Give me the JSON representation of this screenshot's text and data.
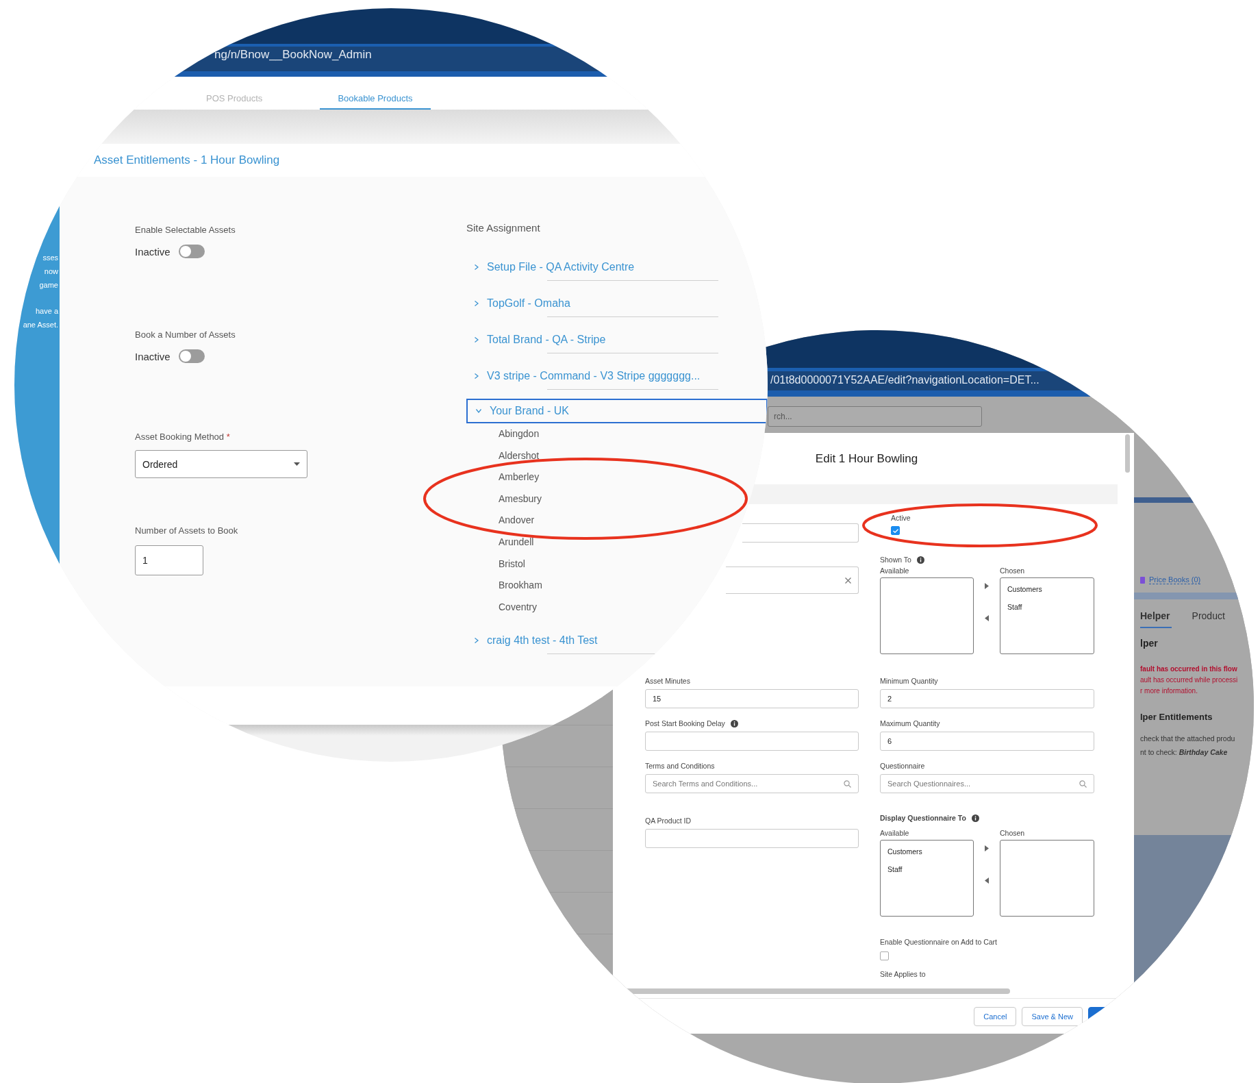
{
  "left_screen": {
    "url": "ng/n/Bnow__BookNow_Admin",
    "tabs": [
      {
        "label": "POS Products",
        "selected": false
      },
      {
        "label": "Bookable Products",
        "selected": true
      }
    ],
    "sidebar_lines": [
      "sses",
      "now",
      "game",
      "have a",
      "ane Asset."
    ],
    "title": "Asset Entitlements - 1 Hour Bowling",
    "toggles": [
      {
        "label": "Enable Selectable Assets",
        "state": "Inactive",
        "on": false
      },
      {
        "label": "Book a Number of Assets",
        "state": "Inactive",
        "on": false
      }
    ],
    "booking_method": {
      "label": "Asset Booking Method",
      "required_mark": "*",
      "value": "Ordered"
    },
    "assets_to_book": {
      "label": "Number of Assets to Book",
      "value": "1"
    },
    "site_assignment": {
      "title": "Site Assignment",
      "items": [
        {
          "label": "Setup File - QA Activity Centre",
          "expanded": false,
          "selected": false
        },
        {
          "label": "TopGolf - Omaha",
          "expanded": false,
          "selected": false
        },
        {
          "label": "Total Brand - QA - Stripe",
          "expanded": false,
          "selected": false
        },
        {
          "label": "V3 stripe - Command - V3 Stripe ggggggg...",
          "expanded": false,
          "selected": false
        },
        {
          "label": "Your Brand - UK",
          "expanded": true,
          "selected": true,
          "children": [
            {
              "label": "Abingdon"
            },
            {
              "label": "Aldershot"
            },
            {
              "label": "Amberley"
            },
            {
              "label": "Amesbury"
            },
            {
              "label": "Andover"
            },
            {
              "label": "Arundell"
            },
            {
              "label": "Bristol"
            },
            {
              "label": "Brookham"
            },
            {
              "label": "Coventry"
            }
          ]
        },
        {
          "label": "craig 4th test - 4th Test",
          "expanded": false,
          "selected": false
        }
      ]
    },
    "highlights": [
      {
        "kind": "ellipse"
      }
    ]
  },
  "right_screen": {
    "url": "/01t8d0000071Y52AAE/edit?navigationLocation=DET...",
    "search": {
      "placeholder": "rch..."
    },
    "modal": {
      "title": "Edit 1 Hour Bowling",
      "unlabeled_fields": [
        {
          "clearable": false
        },
        {
          "clearable": true
        }
      ],
      "active": {
        "label": "Active",
        "checked": true
      },
      "shown_to": {
        "label": "Shown To",
        "info": true,
        "available_label": "Available",
        "chosen_label": "Chosen",
        "chosen": [
          "Customers",
          "Staff"
        ]
      },
      "left_fields": [
        {
          "label": "Asset Minutes",
          "kind": "text",
          "value": "15"
        },
        {
          "label": "Post Start Booking Delay",
          "kind": "text",
          "info": true
        },
        {
          "label": "Terms and Conditions",
          "kind": "search",
          "placeholder": "Search Terms and Conditions..."
        },
        {
          "label": "QA Product ID",
          "kind": "text"
        }
      ],
      "right_fields": [
        {
          "label": "Minimum Quantity",
          "kind": "text",
          "value": "2"
        },
        {
          "label": "Maximum Quantity",
          "kind": "text",
          "value": "6"
        },
        {
          "label": "Questionnaire",
          "kind": "search",
          "placeholder": "Search Questionnaires..."
        }
      ],
      "display_questionnaire": {
        "label": "Display Questionnaire To",
        "info": true,
        "available_label": "Available",
        "chosen_label": "Chosen",
        "available": [
          "Customers",
          "Staff"
        ]
      },
      "enable_on_cart": {
        "label": "Enable Questionnaire on Add to Cart",
        "checked": false
      },
      "site_applies": {
        "label": "Site Applies to"
      },
      "buttons": [
        {
          "label": "Cancel",
          "kind": "neutral"
        },
        {
          "label": "Save & New",
          "kind": "neutral"
        },
        {
          "kind": "brand"
        }
      ]
    },
    "side_panel": {
      "related_link": "Price Books (0)",
      "tabs": [
        {
          "label": "Helper",
          "selected": true
        },
        {
          "label": "Product",
          "selected": false
        }
      ],
      "heading": "lper",
      "error_lines": [
        "fault has occurred in this flow",
        "ault has occurred while processi",
        "r more information."
      ],
      "subheading": "lper Entitlements",
      "text_lines": [
        "check that the attached produ",
        "nt to check: **Birthday Cake**"
      ]
    },
    "highlights": [
      {
        "kind": "ellipse"
      }
    ]
  }
}
